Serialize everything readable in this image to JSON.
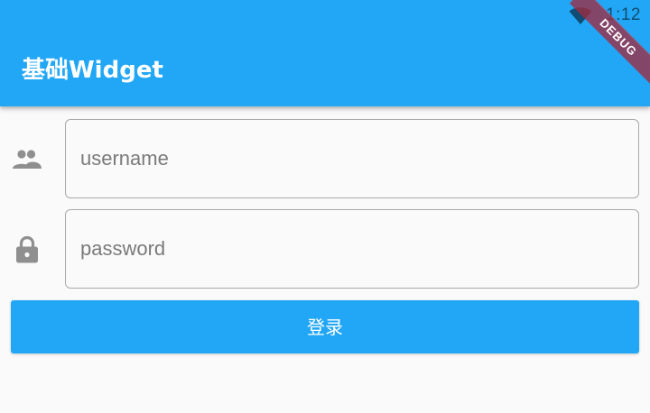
{
  "status_bar": {
    "time": "1:12",
    "wifi_icon": "wifi-icon"
  },
  "app_bar": {
    "title": "基础Widget",
    "color": "#22a7f6"
  },
  "debug_banner": {
    "label": "DEBUG",
    "color": "#a02a40"
  },
  "form": {
    "username": {
      "icon": "people-icon",
      "placeholder": "username",
      "value": ""
    },
    "password": {
      "icon": "lock-icon",
      "placeholder": "password",
      "value": ""
    },
    "login_button": {
      "label": "登录",
      "color": "#22a7f6"
    }
  }
}
